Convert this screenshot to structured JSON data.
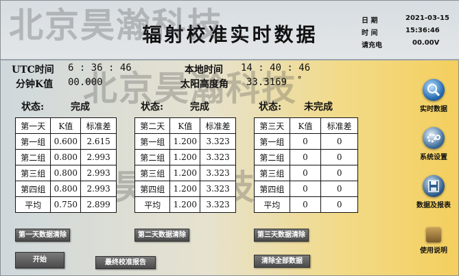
{
  "header": {
    "title": "辐射校准实时数据",
    "date_label": "日  期",
    "date_value": "2021-03-15",
    "time_label": "时  间",
    "time_value": "15:36:46",
    "charge_label": "请充电",
    "charge_value": "00.00V"
  },
  "watermark": "北京昊瀚科技",
  "info": {
    "utc_label": "UTC时间",
    "utc_value": "6 : 36 : 46",
    "local_label": "本地时间",
    "local_value": "14 : 40 : 46",
    "kmin_label": "分钟K值",
    "kmin_value": "00.000",
    "sun_label": "太阳高度角",
    "sun_value": "33.3169",
    "sun_unit": "°"
  },
  "panels": [
    {
      "status_label": "状态:",
      "status_value": "完成",
      "headers": [
        "第一天",
        "K值",
        "标准差"
      ],
      "rows": [
        [
          "第一组",
          "0.600",
          "2.615"
        ],
        [
          "第二组",
          "0.800",
          "2.993"
        ],
        [
          "第三组",
          "0.800",
          "2.993"
        ],
        [
          "第四组",
          "0.800",
          "2.993"
        ],
        [
          "平均",
          "0.750",
          "2.899"
        ]
      ],
      "clear_label": "第一天数据清除"
    },
    {
      "status_label": "状态:",
      "status_value": "完成",
      "headers": [
        "第二天",
        "K值",
        "标准差"
      ],
      "rows": [
        [
          "第一组",
          "1.200",
          "3.323"
        ],
        [
          "第二组",
          "1.200",
          "3.323"
        ],
        [
          "第三组",
          "1.200",
          "3.323"
        ],
        [
          "第四组",
          "1.200",
          "3.323"
        ],
        [
          "平均",
          "1.200",
          "3.323"
        ]
      ],
      "clear_label": "第二天数据清除"
    },
    {
      "status_label": "状态:",
      "status_value": "未完成",
      "headers": [
        "第三天",
        "K值",
        "标准差"
      ],
      "rows": [
        [
          "第一组",
          "0",
          "0"
        ],
        [
          "第二组",
          "0",
          "0"
        ],
        [
          "第三组",
          "0",
          "0"
        ],
        [
          "第四组",
          "0",
          "0"
        ],
        [
          "平均",
          "0",
          "0"
        ]
      ],
      "clear_label": "第三天数据清除"
    }
  ],
  "buttons": {
    "start": "开始",
    "final_report": "最终校准报告",
    "clear_all": "清除全部数据"
  },
  "sidebar": [
    {
      "label": "实时数据",
      "icon": "magnifier-globe-icon",
      "color": "#2a6fb5"
    },
    {
      "label": "系统设置",
      "icon": "gear-icon",
      "color": "#3d6d9c"
    },
    {
      "label": "数据及报表",
      "icon": "floppy-disk-icon",
      "color": "#2f5d8a"
    },
    {
      "label": "使用说明",
      "icon": "help-book-icon",
      "color": "#7a5a2a"
    }
  ]
}
